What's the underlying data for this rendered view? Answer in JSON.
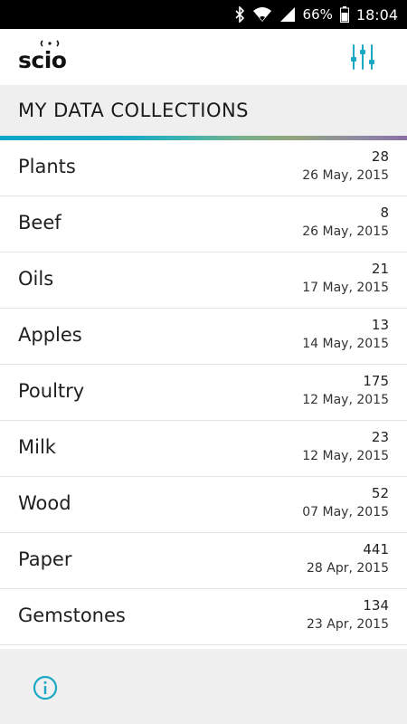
{
  "status_bar": {
    "battery_percent": "66%",
    "time": "18:04",
    "icons": [
      "bluetooth-icon",
      "wifi-icon",
      "signal-icon",
      "battery-icon"
    ]
  },
  "app_bar": {
    "logo_text": "scio",
    "filter_icon": "sliders-icon"
  },
  "header": {
    "title": "MY DATA COLLECTIONS"
  },
  "colors": {
    "accent": "#1aa9c4",
    "header_bg": "#efefef",
    "footer_bg": "#f0f0f0"
  },
  "collections": [
    {
      "name": "Plants",
      "count": "28",
      "date": "26 May, 2015"
    },
    {
      "name": "Beef",
      "count": "8",
      "date": "26 May, 2015"
    },
    {
      "name": "Oils",
      "count": "21",
      "date": "17 May, 2015"
    },
    {
      "name": "Apples",
      "count": "13",
      "date": "14 May, 2015"
    },
    {
      "name": "Poultry",
      "count": "175",
      "date": "12 May, 2015"
    },
    {
      "name": "Milk",
      "count": "23",
      "date": "12 May, 2015"
    },
    {
      "name": "Wood",
      "count": "52",
      "date": "07 May, 2015"
    },
    {
      "name": "Paper",
      "count": "441",
      "date": "28 Apr, 2015"
    },
    {
      "name": "Gemstones",
      "count": "134",
      "date": "23 Apr, 2015"
    }
  ],
  "footer": {
    "info_icon": "info-icon"
  }
}
